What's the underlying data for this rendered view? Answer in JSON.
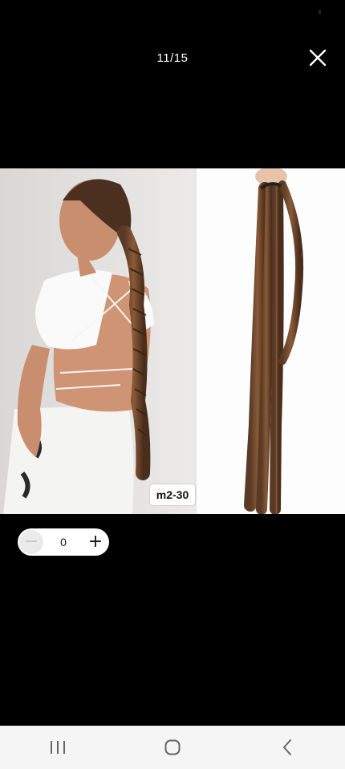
{
  "viewer": {
    "counter": "11/15"
  },
  "product_image": {
    "variant_label": "m2-30"
  },
  "quantity": {
    "value": "0",
    "decrement_symbol": "−",
    "increment_symbol": "+"
  },
  "icons": {
    "close": "close-icon",
    "recent_apps": "recent-apps-icon",
    "home": "home-icon",
    "back": "back-icon"
  },
  "colors": {
    "background": "#000000",
    "nav_bar": "#f5f5f5",
    "stepper_bg": "#ffffff",
    "minus_disabled": "#c8c8c8"
  }
}
